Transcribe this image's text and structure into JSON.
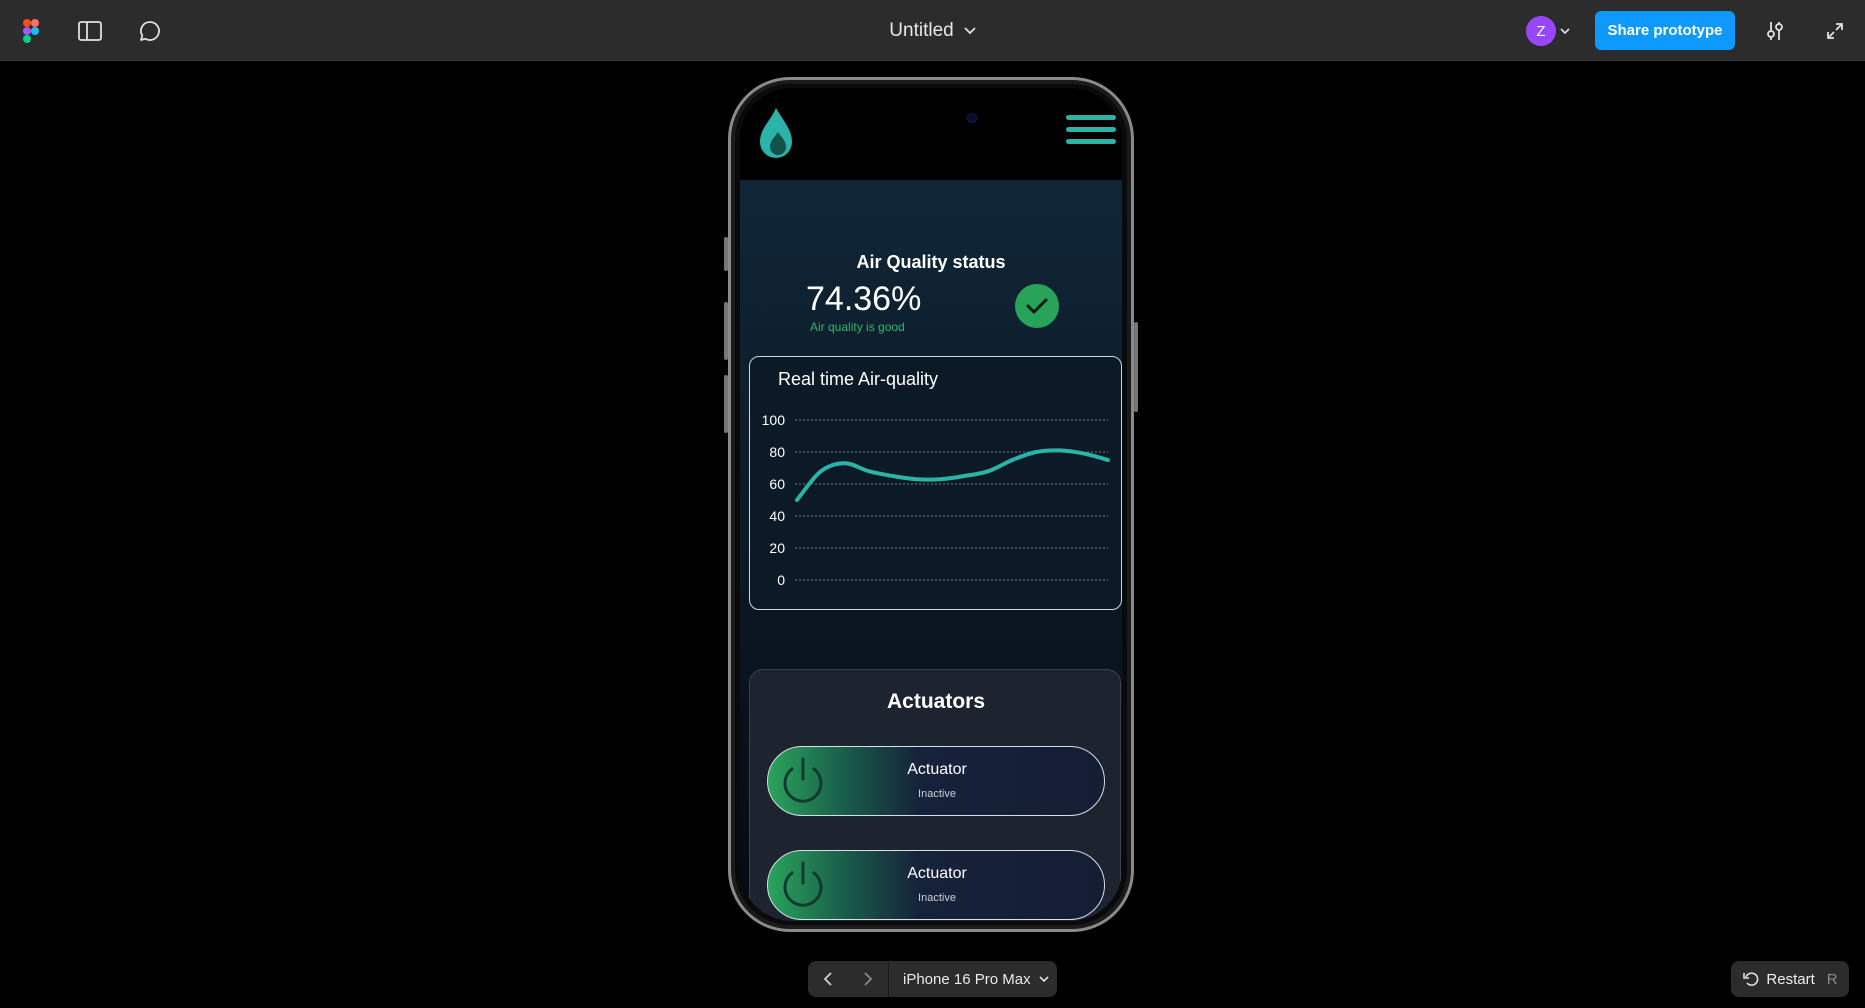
{
  "toolbar": {
    "file_title": "Untitled",
    "avatar_initial": "Z",
    "share_label": "Share prototype",
    "brand_color": "#0d99ff"
  },
  "app": {
    "accent_color": "#2ab3a6",
    "air_quality": {
      "title": "Air Quality status",
      "value": "74.36%",
      "status_text": "Air quality is good",
      "status_color": "#27a35a"
    },
    "chart": {
      "title": "Real time Air-quality"
    },
    "actuators": {
      "title": "Actuators",
      "items": [
        {
          "label": "Actuator",
          "status": "Inactive"
        },
        {
          "label": "Actuator",
          "status": "Inactive"
        }
      ]
    }
  },
  "chart_data": {
    "type": "line",
    "title": "Real time Air-quality",
    "xlabel": "",
    "ylabel": "",
    "ylim": [
      0,
      100
    ],
    "yticks": [
      100,
      80,
      60,
      40,
      20,
      0
    ],
    "grid": true,
    "series": [
      {
        "values": [
          50,
          68,
          73,
          68,
          65,
          63,
          63,
          65,
          68,
          75,
          80,
          81,
          79,
          75
        ]
      }
    ]
  },
  "bottom": {
    "device": "iPhone 16 Pro Max",
    "restart_label": "Restart",
    "restart_key": "R"
  }
}
